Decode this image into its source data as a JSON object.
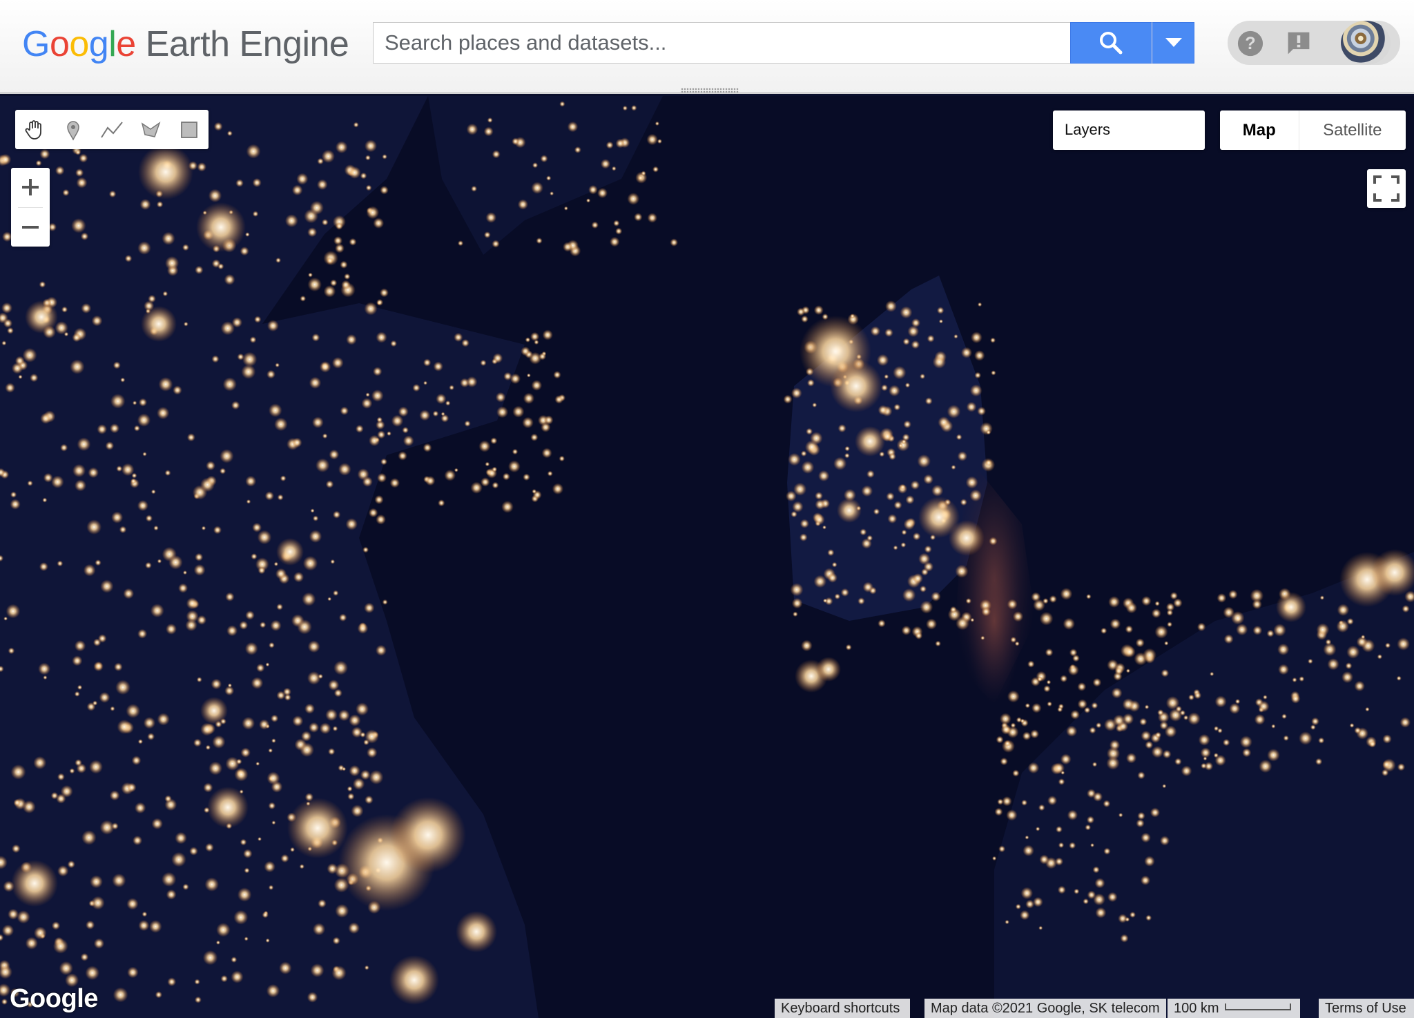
{
  "app": {
    "logo_google": [
      "G",
      "o",
      "o",
      "g",
      "l",
      "e"
    ],
    "logo_product": "Earth Engine"
  },
  "search": {
    "placeholder": "Search places and datasets...",
    "value": ""
  },
  "header": {
    "help_icon": "help-icon",
    "feedback_icon": "feedback-icon",
    "avatar": "user-avatar"
  },
  "map": {
    "drawing_tools": [
      "pan-hand-icon",
      "marker-icon",
      "line-icon",
      "polygon-icon",
      "rectangle-icon"
    ],
    "zoom_in": "+",
    "zoom_out": "−",
    "layers_label": "Layers",
    "map_type": {
      "map": "Map",
      "satellite": "Satellite",
      "selected": "Map"
    },
    "google_logo": "Google",
    "footer": {
      "keyboard": "Keyboard shortcuts",
      "attribution": "Map data ©2021 Google, SK telecom",
      "scale": "100 km",
      "terms": "Terms of Use"
    }
  },
  "colors": {
    "accent": "#4a8af4",
    "map_background": "#080c26",
    "light_glow": "#ffe6c0"
  }
}
